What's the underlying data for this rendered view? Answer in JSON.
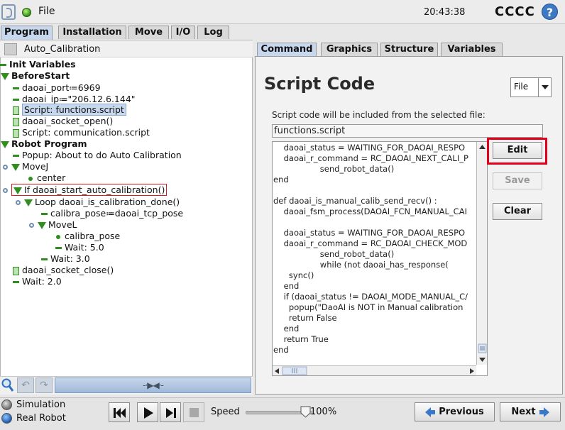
{
  "topbar": {
    "file_menu": "File",
    "clock": "20:43:38",
    "robot_name": "CCCC",
    "help": "?"
  },
  "main_tabs": [
    {
      "label": "Program",
      "active": true
    },
    {
      "label": "Installation",
      "active": false
    },
    {
      "label": "Move",
      "active": false
    },
    {
      "label": "I/O",
      "active": false
    },
    {
      "label": "Log",
      "active": false
    }
  ],
  "program": {
    "name": "Auto_Calibration",
    "tree": [
      {
        "text": "Init Variables",
        "icon": "dash-icon",
        "bold": true
      },
      {
        "text": "BeforeStart",
        "icon": "expand-triangle-icon",
        "bold": true
      },
      {
        "text": "daoai_port≔6969",
        "icon": "dash-icon"
      },
      {
        "text": "daoai_ip≔\"206.12.6.144\"",
        "icon": "dash-icon"
      },
      {
        "text": "Script: functions.script",
        "icon": "script-icon",
        "selected": true
      },
      {
        "text": "daoai_socket_open()",
        "icon": "script-icon"
      },
      {
        "text": "Script: communication.script",
        "icon": "script-icon"
      },
      {
        "text": "Robot Program",
        "icon": "expand-triangle-icon",
        "bold": true
      },
      {
        "text": "Popup: About to do Auto Calibration",
        "icon": "dash-icon"
      },
      {
        "text": "MoveJ",
        "icon": "expand-triangle-icon"
      },
      {
        "text": "center",
        "icon": "waypoint-icon"
      },
      {
        "text": "If daoai_start_auto_calibration()",
        "icon": "expand-triangle-icon",
        "highlighted": true
      },
      {
        "text": "Loop daoai_is_calibration_done()",
        "icon": "expand-triangle-icon"
      },
      {
        "text": "calibra_pose≔daoai_tcp_pose",
        "icon": "dash-icon"
      },
      {
        "text": "MoveL",
        "icon": "expand-triangle-icon"
      },
      {
        "text": "calibra_pose",
        "icon": "waypoint-icon"
      },
      {
        "text": "Wait: 5.0",
        "icon": "dash-icon"
      },
      {
        "text": "Wait: 3.0",
        "icon": "dash-icon"
      },
      {
        "text": "daoai_socket_close()",
        "icon": "script-icon"
      },
      {
        "text": "Wait: 2.0",
        "icon": "dash-icon"
      }
    ],
    "drag_handle": "-·▶◀·-"
  },
  "right_tabs": [
    {
      "label": "Command",
      "active": true
    },
    {
      "label": "Graphics",
      "active": false
    },
    {
      "label": "Structure",
      "active": false
    },
    {
      "label": "Variables",
      "active": false
    }
  ],
  "script_panel": {
    "title": "Script Code",
    "mode": {
      "selected": "File"
    },
    "info": "Script code will be included from the selected file:",
    "filename": "functions.script",
    "code_lines": [
      "    daoai_status = WAITING_FOR_DAOAI_RESPO",
      "    daoai_r_command = RC_DAOAI_NEXT_CALI_P",
      "                  send_robot_data()",
      "end",
      "",
      "def daoai_is_manual_calib_send_recv() :",
      "    daoai_fsm_process(DAOAI_FCN_MANUAL_CAI",
      "",
      "    daoai_status = WAITING_FOR_DAOAI_RESPO",
      "    daoai_r_command = RC_DAOAI_CHECK_MOD",
      "                  send_robot_data()",
      "                  while (not daoai_has_response(",
      "      sync()",
      "    end",
      "    if (daoai_status != DAOAI_MODE_MANUAL_C/",
      "      popup(\"DaoAI is NOT in Manual calibration",
      "      return False",
      "    end",
      "    return True",
      "end"
    ],
    "buttons": {
      "edit": "Edit",
      "save": "Save",
      "clear": "Clear"
    }
  },
  "bottombar": {
    "simulation_label": "Simulation",
    "real_robot_label": "Real Robot",
    "speed_label": "Speed",
    "speed_value": "100%",
    "speed_fraction": 1.0,
    "previous_label": "Previous",
    "next_label": "Next"
  },
  "colors": {
    "accent_blue": "#c7d8ee",
    "tree_green": "#2e8f1e",
    "highlight_red": "#e2001a",
    "nav_arrow_blue": "#3a78c9"
  }
}
